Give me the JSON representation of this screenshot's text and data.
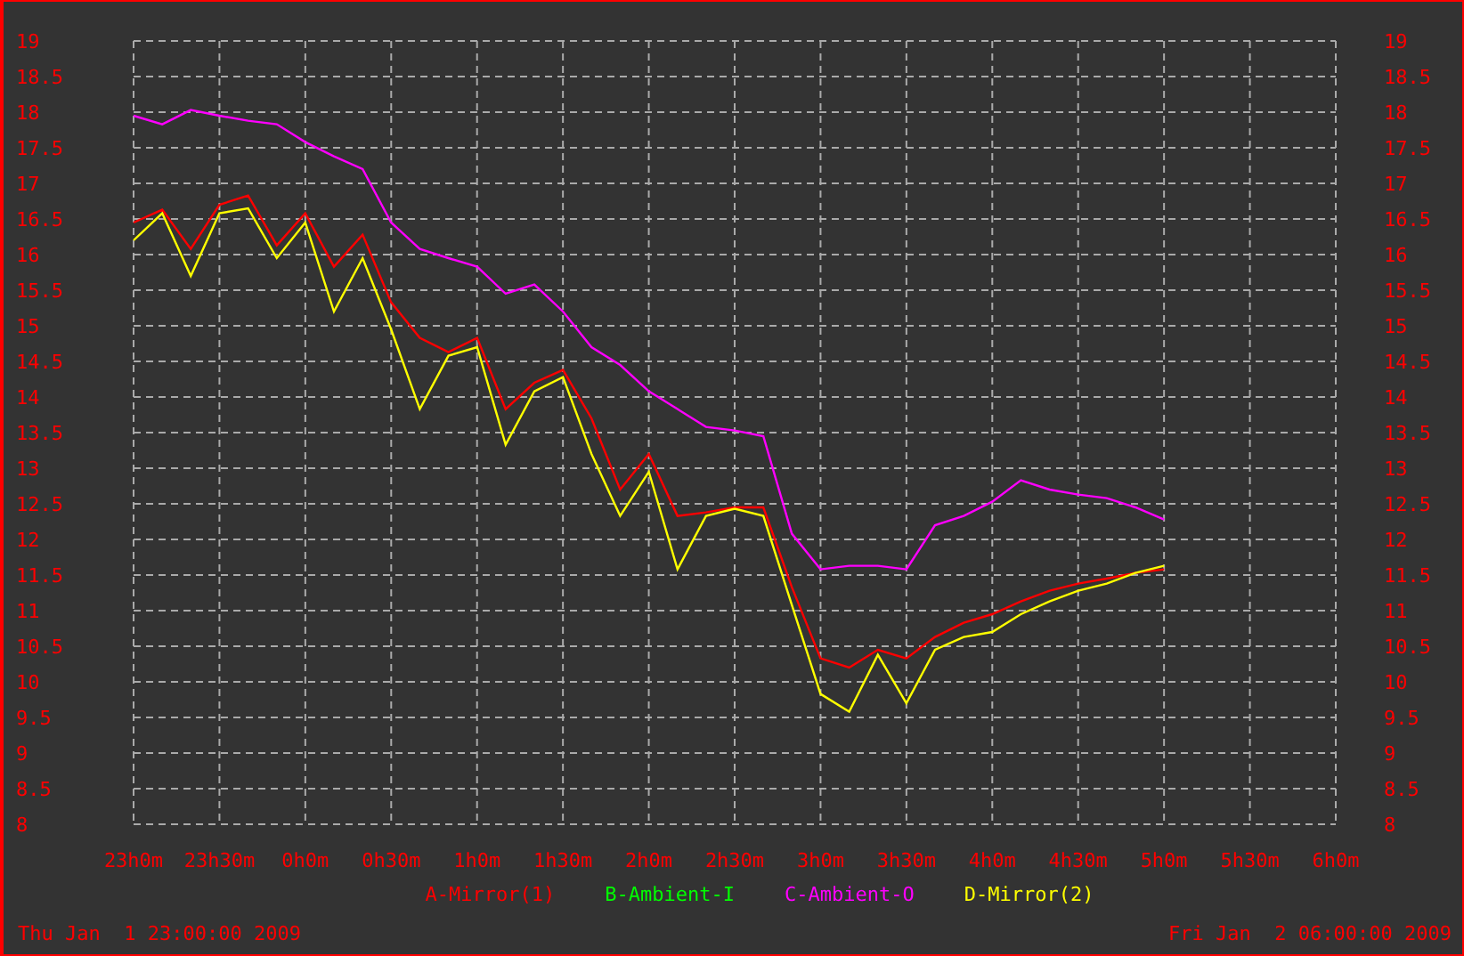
{
  "chart_data": {
    "type": "line",
    "categories": [
      "23h0m",
      null,
      null,
      "23h30m",
      null,
      null,
      "0h0m",
      null,
      null,
      "0h30m",
      null,
      null,
      "1h0m",
      null,
      null,
      "1h30m",
      null,
      null,
      "2h0m",
      null,
      null,
      "2h30m",
      null,
      null,
      "3h0m",
      null,
      null,
      "3h30m",
      null,
      null,
      "4h0m",
      null,
      null,
      "4h30m",
      null,
      null,
      "5h0m",
      null,
      null,
      "5h30m",
      null,
      null,
      "6h0m"
    ],
    "ylim": [
      8,
      19
    ],
    "y2lim": [
      8,
      19
    ],
    "grid": true,
    "yticks": [
      8,
      8.5,
      9,
      9.5,
      10,
      10.5,
      11,
      11.5,
      12,
      12.5,
      13,
      13.5,
      14,
      14.5,
      15,
      15.5,
      16,
      16.5,
      17,
      17.5,
      18,
      18.5,
      19
    ],
    "y2ticks": [
      8,
      8.5,
      9,
      9.5,
      10,
      10.5,
      11,
      11.5,
      12,
      12.5,
      13,
      13.5,
      14,
      14.5,
      15,
      15.5,
      16,
      16.5,
      17,
      17.5,
      18,
      18.5,
      19
    ],
    "series": [
      {
        "name": "A-Mirror(1)",
        "color": "#ff0000",
        "values": [
          16.45,
          16.63,
          16.08,
          16.7,
          16.83,
          16.13,
          16.58,
          15.83,
          16.28,
          15.33,
          14.83,
          14.63,
          14.83,
          13.83,
          14.2,
          14.38,
          13.7,
          12.7,
          13.2,
          12.33,
          12.38,
          12.45,
          12.45,
          11.33,
          10.33,
          10.2,
          10.45,
          10.33,
          10.63,
          10.83,
          10.95,
          11.13,
          11.28,
          11.38,
          11.45,
          11.53,
          11.58,
          null,
          null,
          null,
          null,
          null,
          null
        ]
      },
      {
        "name": "B-Ambient-I",
        "color": "#00ff00",
        "values": [
          null,
          null,
          null,
          null,
          null,
          null,
          null,
          null,
          null,
          null,
          null,
          null,
          null,
          null,
          null,
          null,
          null,
          null,
          null,
          null,
          null,
          null,
          null,
          null,
          null,
          null,
          null,
          null,
          null,
          null,
          null,
          null,
          null,
          null,
          null,
          null,
          null,
          null,
          null,
          null,
          null,
          null,
          null
        ]
      },
      {
        "name": "C-Ambient-O",
        "color": "#ff00ff",
        "values": [
          17.95,
          17.83,
          18.03,
          17.95,
          17.88,
          17.83,
          17.58,
          17.38,
          17.2,
          16.45,
          16.08,
          15.95,
          15.83,
          15.45,
          15.58,
          15.2,
          14.7,
          14.45,
          14.08,
          13.83,
          13.58,
          13.53,
          13.45,
          12.08,
          11.58,
          11.63,
          11.63,
          11.58,
          12.2,
          12.33,
          12.53,
          12.83,
          12.7,
          12.63,
          12.58,
          12.45,
          12.28,
          null,
          null,
          null,
          null,
          null,
          null
        ]
      },
      {
        "name": "D-Mirror(2)",
        "color": "#ffff00",
        "values": [
          16.2,
          16.58,
          15.7,
          16.58,
          16.65,
          15.95,
          16.45,
          15.2,
          15.95,
          14.95,
          13.83,
          14.58,
          14.7,
          13.33,
          14.08,
          14.28,
          13.2,
          12.33,
          12.95,
          11.58,
          12.33,
          12.43,
          12.33,
          11.08,
          9.83,
          9.58,
          10.38,
          9.7,
          10.45,
          10.63,
          10.7,
          10.95,
          11.13,
          11.28,
          11.38,
          11.53,
          11.63,
          null,
          null,
          null,
          null,
          null,
          null
        ]
      }
    ]
  },
  "footer": {
    "start": "Thu Jan  1 23:00:00 2009",
    "end": "Fri Jan  2 06:00:00 2009"
  }
}
